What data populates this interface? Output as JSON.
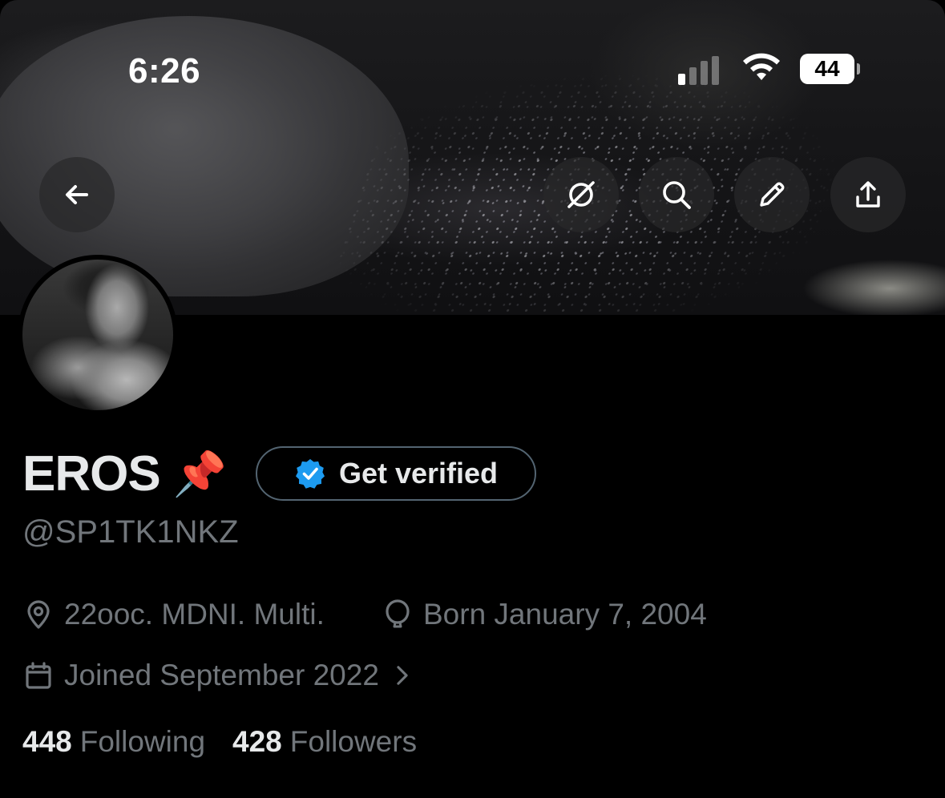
{
  "status_bar": {
    "time": "6:26",
    "battery": "44"
  },
  "profile": {
    "display_name": "EROS",
    "name_emoji": "📌",
    "get_verified_label": "Get verified",
    "handle": "@SP1TK1NKZ",
    "location": "22ooc. MDNI. Multi.",
    "birthday": "Born January 7, 2004",
    "joined": "Joined September 2022"
  },
  "stats": {
    "following_count": "448",
    "following_label": "Following",
    "followers_count": "428",
    "followers_label": "Followers"
  },
  "icons": {
    "back": "arrow-left-icon",
    "grok": "slashed-circle-icon",
    "search": "search-icon",
    "edit": "pencil-icon",
    "share": "share-icon",
    "location": "location-pin-icon",
    "birthday": "balloon-icon",
    "joined": "calendar-icon",
    "verified": "verified-badge-icon"
  },
  "colors": {
    "accent": "#1d9bf0",
    "muted": "#71767b",
    "text": "#e7e9ea",
    "background": "#000000"
  }
}
